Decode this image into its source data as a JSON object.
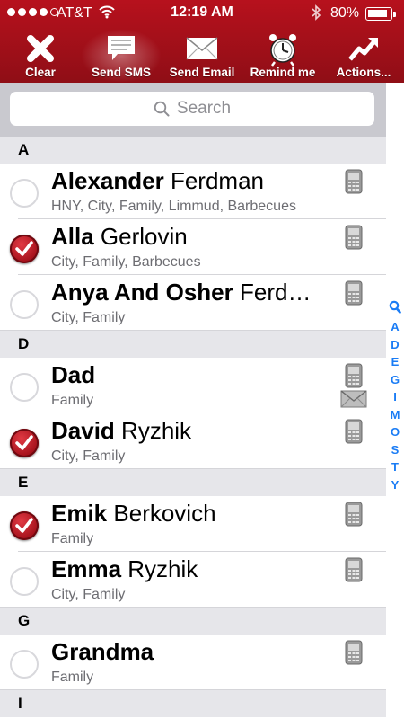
{
  "status_bar": {
    "carrier": "AT&T",
    "time": "12:19 AM",
    "battery": "80%",
    "battery_level": 0.8,
    "signal_bars_filled": 4,
    "signal_bars_total": 5
  },
  "toolbar": {
    "items": [
      {
        "label": "Clear",
        "icon": "close-x-icon"
      },
      {
        "label": "Send SMS",
        "icon": "sms-bubble-icon"
      },
      {
        "label": "Send Email",
        "icon": "envelope-icon"
      },
      {
        "label": "Remind me",
        "icon": "alarm-clock-icon"
      },
      {
        "label": "Actions...",
        "icon": "trend-arrow-icon"
      }
    ],
    "active": "Send SMS"
  },
  "search": {
    "placeholder": "Search"
  },
  "sections": [
    {
      "letter": "A",
      "contacts": [
        {
          "first": "Alexander",
          "last": "Ferdman",
          "groups": "HNY, City, Family, Limmud, Barbecues",
          "checked": false,
          "phone": true,
          "email": false
        },
        {
          "first": "Alla",
          "last": "Gerlovin",
          "groups": "City, Family, Barbecues",
          "checked": true,
          "phone": true,
          "email": false
        },
        {
          "first": "Anya And Osher",
          "last": "Ferd…",
          "groups": "City, Family",
          "checked": false,
          "phone": true,
          "email": false
        }
      ]
    },
    {
      "letter": "D",
      "contacts": [
        {
          "first": "Dad",
          "last": "",
          "groups": "Family",
          "checked": false,
          "phone": true,
          "email": true
        },
        {
          "first": "David",
          "last": "Ryzhik",
          "groups": "City, Family",
          "checked": true,
          "phone": true,
          "email": false
        }
      ]
    },
    {
      "letter": "E",
      "contacts": [
        {
          "first": "Emik",
          "last": "Berkovich",
          "groups": "Family",
          "checked": true,
          "phone": true,
          "email": false
        },
        {
          "first": "Emma",
          "last": "Ryzhik",
          "groups": "City, Family",
          "checked": false,
          "phone": true,
          "email": false
        }
      ]
    },
    {
      "letter": "G",
      "contacts": [
        {
          "first": "Grandma",
          "last": "",
          "groups": "Family",
          "checked": false,
          "phone": true,
          "email": false
        }
      ]
    },
    {
      "letter": "I",
      "contacts": []
    }
  ],
  "index_bar": {
    "letters": [
      "A",
      "D",
      "E",
      "G",
      "I",
      "M",
      "O",
      "S",
      "T",
      "Y"
    ],
    "icon": "search-icon",
    "color": "#1a7cf5"
  },
  "colors": {
    "header": "#a3101a",
    "check_on": "#b3121c",
    "section_bg": "#e6e6ea"
  }
}
